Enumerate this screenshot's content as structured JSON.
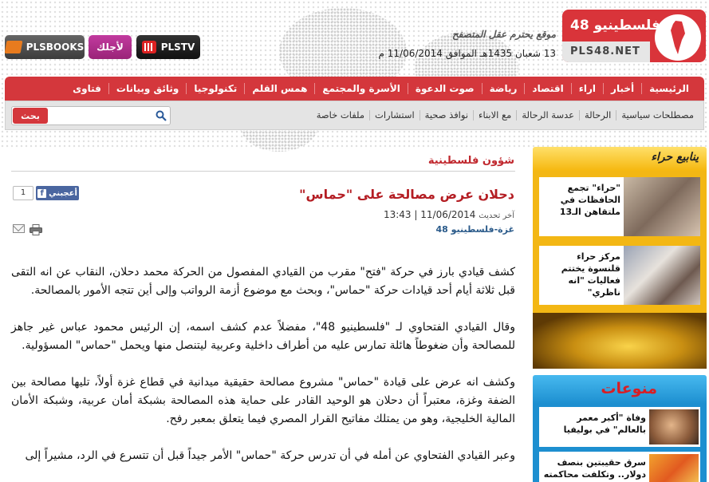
{
  "header": {
    "logo_title": "فلسطينيو 48",
    "logo_url": "PLS48.NET",
    "tagline": "موقع يحترم عقل المتصفح",
    "date": "13 شعبان 1435هـ الموافق 11/06/2014 م",
    "buttons": {
      "books": "PLSBOOKS",
      "ajlek": "لأجلك",
      "tv": "PLSTV"
    }
  },
  "nav": {
    "main": [
      "الرئيسية",
      "أخبار",
      "اراء",
      "اقتصاد",
      "رياضة",
      "صوت الدعوة",
      "الأسرة والمجتمع",
      "همس القلم",
      "تكنولوجيا",
      "وثائق وبيانات",
      "فتاوى"
    ],
    "sub": [
      "مصطلحات سياسية",
      "الرحالة",
      "عدسة الرحالة",
      "مع الابناء",
      "نوافذ صحية",
      "استشارات",
      "ملفات خاصة"
    ],
    "search": {
      "placeholder": "",
      "button": "بحث"
    }
  },
  "article": {
    "section": "شؤون فلسطينية",
    "title": "دحلان عرض مصالحة على \"حماس\"",
    "updated_label": "آخر تحديث",
    "updated_value": "11/06/2014 | 13:43",
    "source": "غزة-فلسطينيو 48",
    "like_label": "أعجبني",
    "like_count": "1",
    "paragraphs": [
      "كشف قيادي بارز في حركة \"فتح\" مقرب من القيادي المفصول من الحركة محمد دحلان، النقاب عن انه التقى قبل ثلاثة أيام أحد قيادات حركة \"حماس\"، وبحث مع موضوع أزمة الرواتب وإلى أين تتجه الأمور بالمصالحة.",
      "وقال القيادي الفتحاوي لـ \"فلسطينيو 48\"، مفضلاً عدم كشف اسمه، إن الرئيس محمود عباس غير جاهز للمصالحة وأن ضغوطاً هائلة تمارس عليه من أطراف داخلية وعربية ليتنصل منها ويحمل \"حماس\" المسؤولية.",
      "وكشف انه عرض على قيادة \"حماس\" مشروع مصالحة حقيقية ميدانية في قطاع غزة أولاً، تليها مصالحة بين الضفة وغزة، معتبراً أن دحلان هو الوحيد القادر على حماية هذه المصالحة بشبكة أمان عربية، وشبكة الأمان المالية الخليجية، وهو من يمتلك مفاتيح القرار المصري فيما يتعلق بمعبر رفح.",
      "وعبر القيادي الفتحاوي عن أمله في أن تدرس حركة \"حماس\" الأمر جيداً قبل أن تتسرع في الرد، مشيراً إلى"
    ]
  },
  "sidebar": {
    "section1_title": "ينابيع حراء",
    "section1_items": [
      "\"حراء\" تجمع الحافظات في ملتقاهن الـ13",
      "مركز حراء قلنسوة يختتم فعاليات \"انه ناظري\""
    ],
    "section2_title": "منوعات",
    "section2_items": [
      "وفاة \"أكبر معمر بالعالم\" في بوليفيا",
      "سرق حقيبتين بنصف دولار.. وتكلفت محاكمته"
    ]
  },
  "colors": {
    "brand_red": "#d4373c",
    "title_red": "#b41d23",
    "sidebar_yellow": "#f3b714",
    "sidebar_blue": "#1d8fd0"
  }
}
